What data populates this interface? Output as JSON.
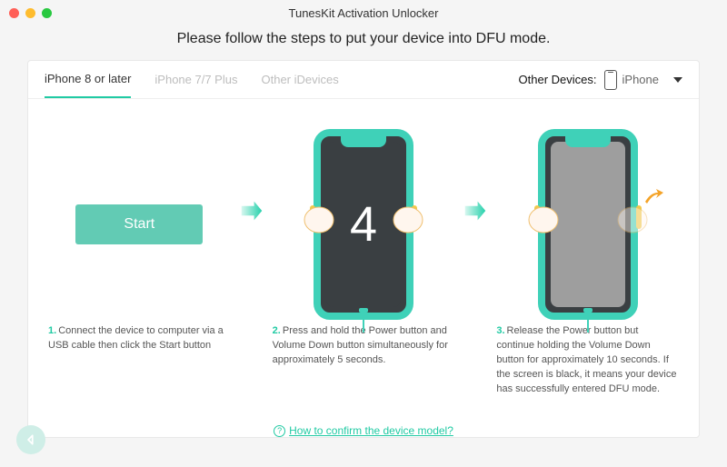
{
  "app_title": "TunesKit Activation Unlocker",
  "instruction": "Please follow the steps to put your device into DFU mode.",
  "tabs": [
    "iPhone 8 or later",
    "iPhone 7/7 Plus",
    "Other iDevices"
  ],
  "active_tab": 0,
  "other_devices_label": "Other Devices:",
  "device_select": {
    "selected": "iPhone"
  },
  "start_label": "Start",
  "countdown_value": "4",
  "steps": [
    {
      "num": "1.",
      "text": "Connect the device to computer via a USB cable then click the Start button"
    },
    {
      "num": "2.",
      "text": "Press and hold the Power button and Volume Down button simultaneously for approximately 5 seconds."
    },
    {
      "num": "3.",
      "text": "Release the Power button but continue holding the Volume Down button for approximately 10 seconds. If the screen is black, it means your device has successfully entered DFU mode."
    }
  ],
  "help_link": "How to confirm the device model?"
}
